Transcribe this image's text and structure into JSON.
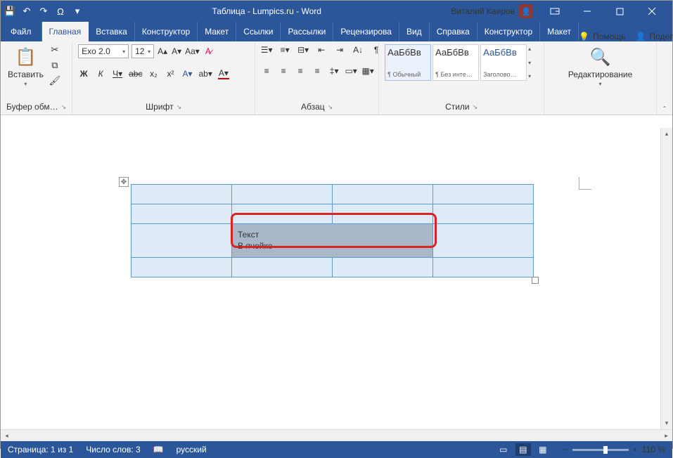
{
  "titlebar": {
    "title": "Таблица - Lumpics.ru - Word",
    "user": "Виталий Каиров"
  },
  "tabs": {
    "file": "Файл",
    "home": "Главная",
    "insert": "Вставка",
    "design": "Конструктор",
    "layout": "Макет",
    "references": "Ссылки",
    "mailings": "Рассылки",
    "review": "Рецензирова",
    "view": "Вид",
    "help": "Справка",
    "tbl_design": "Конструктор",
    "tbl_layout": "Макет",
    "tell_me": "Помощь",
    "share": "Поделиться"
  },
  "ribbon": {
    "clipboard": {
      "paste": "Вставить",
      "label": "Буфер обм…"
    },
    "font": {
      "name": "Exo 2.0",
      "size": "12",
      "bold": "Ж",
      "italic": "К",
      "underline": "Ч",
      "strike": "abc",
      "sub": "x₂",
      "sup": "x²",
      "label": "Шрифт"
    },
    "paragraph": {
      "label": "Абзац"
    },
    "styles": {
      "label": "Стили",
      "items": [
        {
          "sample": "АаБбВв",
          "name": "¶ Обычный"
        },
        {
          "sample": "АаБбВв",
          "name": "¶ Без инте…"
        },
        {
          "sample": "АаБбВв",
          "name": "Заголово…"
        }
      ]
    },
    "editing": {
      "label": "Редактирование"
    }
  },
  "document": {
    "cell_text_line1": "Текст",
    "cell_text_line2": "В ячейке"
  },
  "status": {
    "page": "Страница: 1 из 1",
    "words": "Число слов: 3",
    "lang": "русский",
    "zoom": "110 %"
  }
}
